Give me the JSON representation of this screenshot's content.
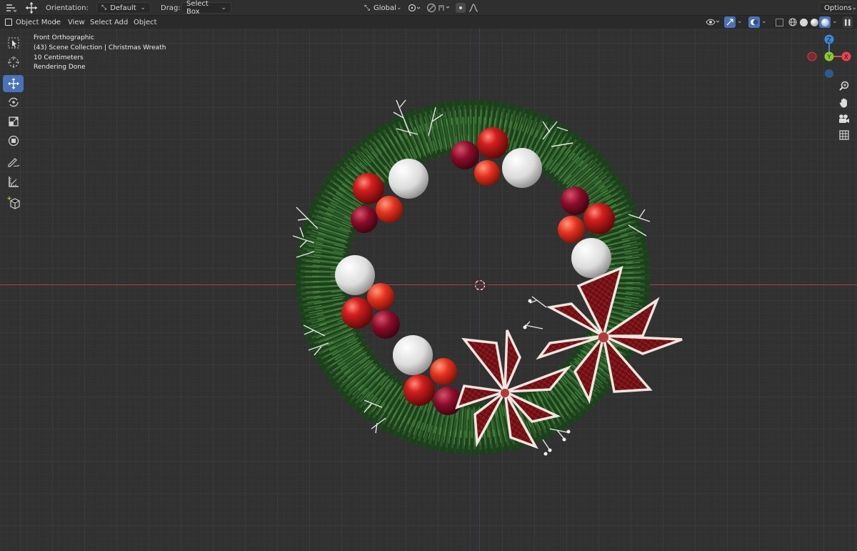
{
  "header": {
    "orientation_label": "Orientation:",
    "orientation_value": "Default",
    "drag_label": "Drag:",
    "drag_value": "Select Box",
    "transform_space": "Global",
    "options_label": "Options"
  },
  "menubar": {
    "mode": "Object Mode",
    "items": [
      "View",
      "Select",
      "Add",
      "Object"
    ]
  },
  "viewport_info": {
    "view_name": "Front Orthographic",
    "collection": "(43) Scene Collection | Christmas Wreath",
    "scale": "10 Centimeters",
    "status": "Rendering Done"
  },
  "gizmo": {
    "z_label": "Z",
    "y_label": "Y",
    "x_label": "X"
  },
  "toolbar": {
    "tools": [
      "select-box",
      "cursor",
      "move",
      "rotate",
      "scale",
      "transform",
      "annotate",
      "measure",
      "add-cube"
    ],
    "active_tool": "move"
  },
  "colors": {
    "accent": "#4a72b8",
    "x_axis": "#a84848",
    "gizmo_x": "#e8464f",
    "gizmo_y": "#8bcc2d",
    "gizmo_z": "#3e86d8"
  }
}
